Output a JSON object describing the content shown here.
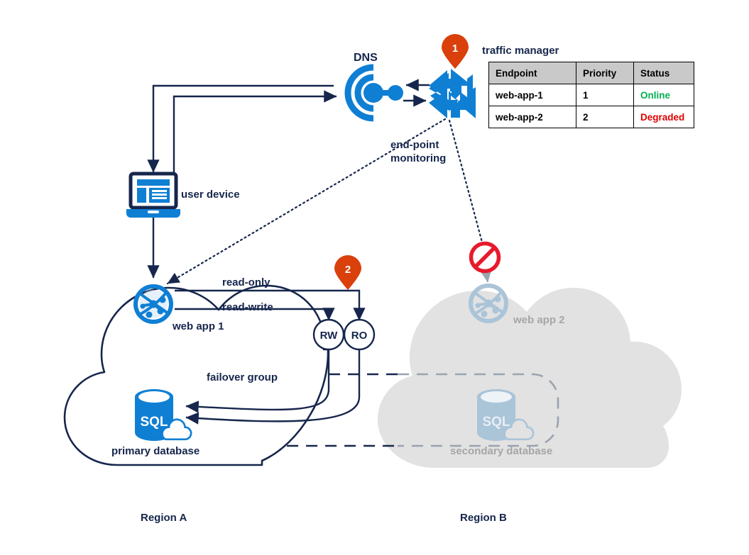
{
  "diagram": {
    "title_labels": {
      "dns": "DNS",
      "traffic_manager": "traffic manager",
      "user_device": "user device",
      "endpoint_monitoring_line1": "end-point",
      "endpoint_monitoring_line2": "monitoring",
      "web_app_1": "web app 1",
      "web_app_2": "web app 2",
      "read_only": "read-only",
      "read_write": "read-write",
      "failover_group": "failover group",
      "primary_database": "primary database",
      "secondary_database": "secondary database",
      "region_a": "Region A",
      "region_b": "Region B",
      "rw_node": "RW",
      "ro_node": "RO",
      "sql_primary": "SQL",
      "sql_secondary": "SQL"
    },
    "step_badges": [
      {
        "number": "1",
        "at": "traffic-manager"
      },
      {
        "number": "2",
        "at": "ro-endpoint"
      }
    ],
    "colors": {
      "azure_blue": "#0f7fd4",
      "navy": "#16264c",
      "orange_badge": "#d9400b",
      "grey_cloud": "#e2e2e2",
      "grey_icon": "#aac4d8",
      "grey_text": "#a6a6a6",
      "status_online": "#00b050",
      "status_degraded": "#e00000",
      "table_header": "#c9c9c9",
      "blocked_red": "#e8192c"
    },
    "icons": [
      "dns-icon",
      "traffic-manager-icon",
      "user-device-icon",
      "web-app-icon",
      "sql-database-icon",
      "blocked-icon",
      "map-pin-badge-icon"
    ]
  },
  "traffic_manager_table": {
    "caption": "traffic manager",
    "columns": [
      "Endpoint",
      "Priority",
      "Status"
    ],
    "rows": [
      {
        "endpoint": "web-app-1",
        "priority": "1",
        "status": "Online",
        "status_state": "online"
      },
      {
        "endpoint": "web-app-2",
        "priority": "2",
        "status": "Degraded",
        "status_state": "degraded"
      }
    ]
  }
}
